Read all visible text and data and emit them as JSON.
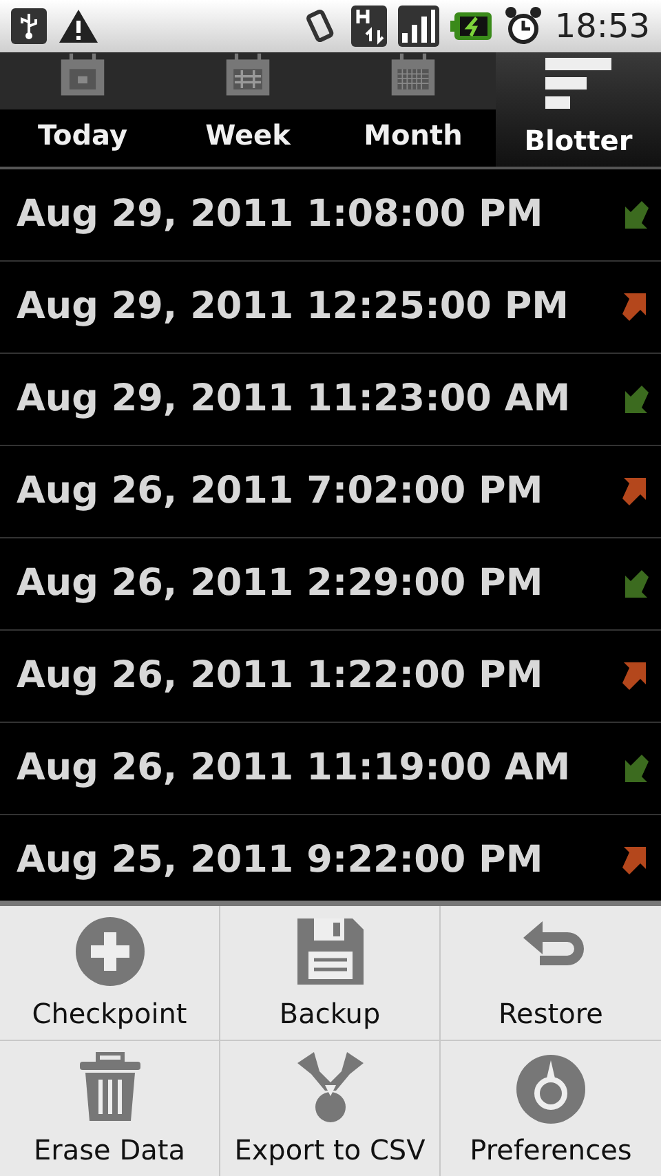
{
  "status_bar": {
    "time": "18:53"
  },
  "tabs": [
    {
      "label": "Today",
      "kind": "day",
      "selected": false
    },
    {
      "label": "Week",
      "kind": "week",
      "selected": false
    },
    {
      "label": "Month",
      "kind": "month",
      "selected": false
    },
    {
      "label": "Blotter",
      "kind": "blotter",
      "selected": true
    }
  ],
  "entries": [
    {
      "time": "Aug 29, 2011 1:08:00 PM",
      "kind": "in"
    },
    {
      "time": "Aug 29, 2011 12:25:00 PM",
      "kind": "out"
    },
    {
      "time": "Aug 29, 2011 11:23:00 AM",
      "kind": "in"
    },
    {
      "time": "Aug 26, 2011 7:02:00 PM",
      "kind": "out"
    },
    {
      "time": "Aug 26, 2011 2:29:00 PM",
      "kind": "in"
    },
    {
      "time": "Aug 26, 2011 1:22:00 PM",
      "kind": "out"
    },
    {
      "time": "Aug 26, 2011 11:19:00 AM",
      "kind": "in"
    },
    {
      "time": "Aug 25, 2011 9:22:00 PM",
      "kind": "out"
    }
  ],
  "menu": [
    {
      "label": "Checkpoint",
      "kind": "plus"
    },
    {
      "label": "Backup",
      "kind": "disk"
    },
    {
      "label": "Restore",
      "kind": "undo"
    },
    {
      "label": "Erase Data",
      "kind": "trash"
    },
    {
      "label": "Export to CSV",
      "kind": "export"
    },
    {
      "label": "Preferences",
      "kind": "gear"
    }
  ]
}
